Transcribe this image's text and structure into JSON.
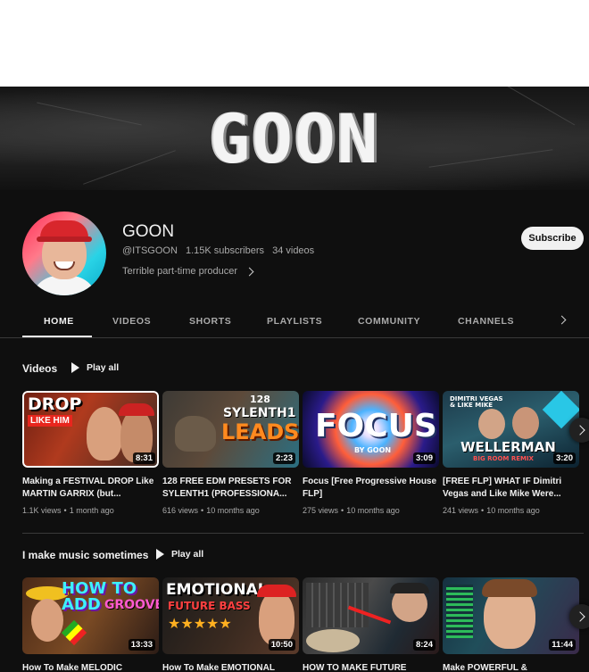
{
  "banner": {
    "title": "GOON"
  },
  "channel": {
    "name": "GOON",
    "handle": "@ITSGOON",
    "subscribers": "1.15K subscribers",
    "video_count": "34 videos",
    "description": "Terrible part-time producer",
    "subscribe_label": "Subscribe"
  },
  "tabs": [
    "HOME",
    "VIDEOS",
    "SHORTS",
    "PLAYLISTS",
    "COMMUNITY",
    "CHANNELS"
  ],
  "active_tab": "HOME",
  "sections": [
    {
      "title": "Videos",
      "play_all": "Play all",
      "videos": [
        {
          "title": "Making a FESTIVAL DROP Like MARTIN GARRIX (but...",
          "duration": "8:31",
          "views": "1.1K views",
          "age": "1 month ago",
          "thumb_text": "DROP LIKE HIM"
        },
        {
          "title": "128 FREE EDM PRESETS FOR SYLENTH1 (PROFESSIONA...",
          "duration": "2:23",
          "views": "616 views",
          "age": "10 months ago",
          "thumb_text": "128 SYLENTH1 LEADS"
        },
        {
          "title": "Focus [Free Progressive House FLP]",
          "duration": "3:09",
          "views": "275 views",
          "age": "10 months ago",
          "thumb_text": "FOCUS BY GOON"
        },
        {
          "title": "[FREE FLP] WHAT IF Dimitri Vegas and Like Mike Were...",
          "duration": "3:20",
          "views": "241 views",
          "age": "10 months ago",
          "thumb_text": "WELLERMAN BIG ROOM REMIX"
        }
      ]
    },
    {
      "title": "I make music sometimes",
      "play_all": "Play all",
      "videos": [
        {
          "title": "How To Make MELODIC",
          "duration": "13:33",
          "thumb_text": "HOW TO ADD GROOVE"
        },
        {
          "title": "How To Make EMOTIONAL",
          "duration": "10:50",
          "thumb_text": "EMOTIONAL FUTURE BASS"
        },
        {
          "title": "HOW TO MAKE FUTURE",
          "duration": "8:24",
          "thumb_text": ""
        },
        {
          "title": "Make POWERFUL &",
          "duration": "11:44",
          "thumb_text": ""
        }
      ]
    }
  ],
  "colors": {
    "background": "#0f0f0f",
    "text": "#f1f1f1",
    "secondary_text": "#aaaaaa",
    "subscribe_bg": "#f1f1f1"
  },
  "icons": [
    "chevron-right-icon",
    "play-icon"
  ]
}
